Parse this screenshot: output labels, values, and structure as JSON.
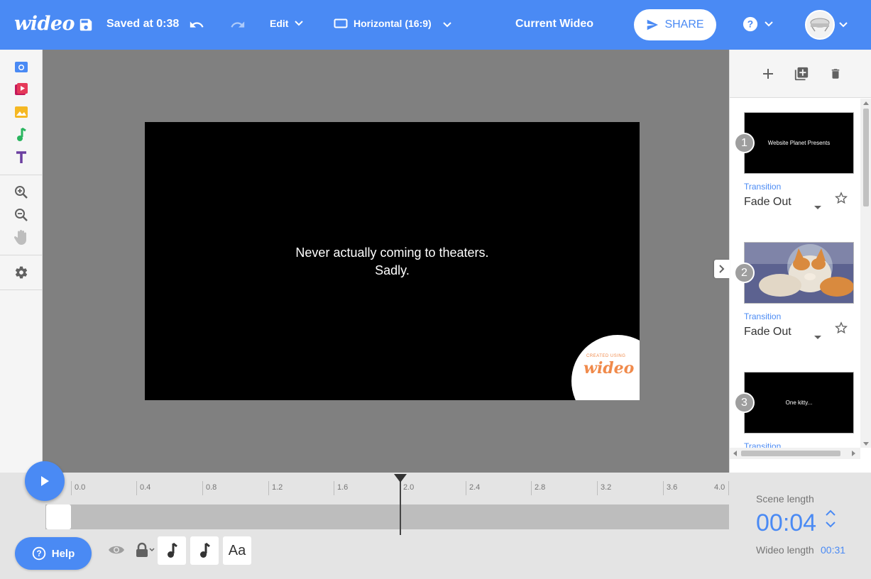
{
  "topbar": {
    "logo": "wideo",
    "saved": "Saved at 0:38",
    "edit": "Edit",
    "format": "Horizontal (16:9)",
    "title": "Current Wideo",
    "share": "SHARE"
  },
  "stage": {
    "line1": "Never actually coming to theaters.",
    "line2": "Sadly.",
    "badge_small": "CREATED USING",
    "badge_logo": "wideo"
  },
  "scenes": [
    {
      "number": "1",
      "thumb_text": "Website Planet Presents",
      "transition_label": "Transition",
      "transition": "Fade Out"
    },
    {
      "number": "2",
      "thumb_text": "",
      "transition_label": "Transition",
      "transition": "Fade Out"
    },
    {
      "number": "3",
      "thumb_text": "One kitty...",
      "transition_label": "Transition",
      "transition": ""
    }
  ],
  "timeline": {
    "ticks": [
      "0.0",
      "0.4",
      "0.8",
      "1.2",
      "1.6",
      "2.0",
      "2.4",
      "2.8",
      "3.2",
      "3.6",
      "4.0"
    ],
    "help": "Help",
    "text_layer": "Aa",
    "scene_length_label": "Scene length",
    "scene_length": "00:04",
    "wideo_length_label": "Wideo length",
    "wideo_length": "00:31"
  },
  "colors": {
    "accent": "#4a8af4",
    "camera_icon": "#4a8af4",
    "video_icon": "#e53958",
    "image_icon": "#f5b823",
    "music_icon": "#2ab55f",
    "text_icon": "#6b3fa0",
    "badge": "#f08a4b"
  }
}
